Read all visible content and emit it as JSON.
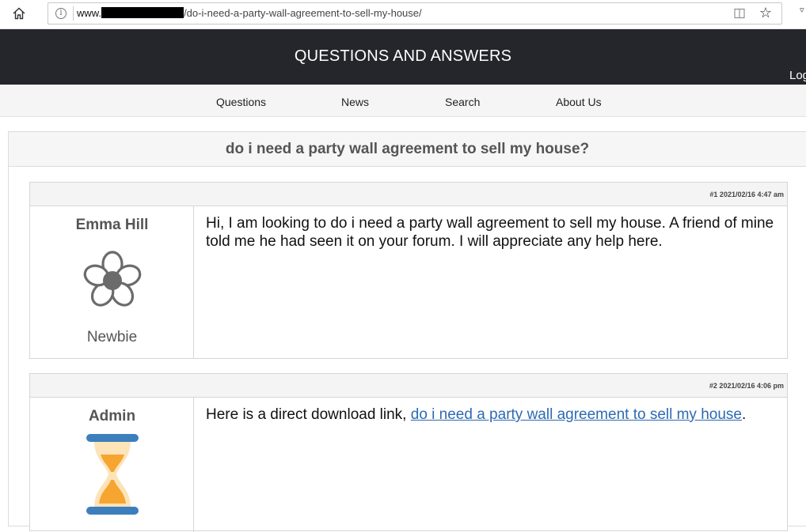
{
  "browser": {
    "url_prefix": "www.",
    "url_path": "/do-i-need-a-party-wall-agreement-to-sell-my-house/"
  },
  "site": {
    "title": "QUESTIONS AND ANSWERS",
    "login_label": "Log"
  },
  "nav": {
    "items": [
      "Questions",
      "News",
      "Search",
      "About Us"
    ]
  },
  "topic": {
    "title": "do i need a party wall agreement to sell my house?"
  },
  "posts": [
    {
      "meta": "#1 2021/02/16 4:47 am",
      "author": "Emma Hill",
      "avatar": "flower-icon",
      "rank": "Newbie",
      "text": "Hi, I am looking to do i need a party wall agreement to sell my house. A friend of mine told me he had seen it on your forum. I will appreciate any help here."
    },
    {
      "meta": "#2 2021/02/16 4:06 pm",
      "author": "Admin",
      "avatar": "hourglass-icon",
      "text_prefix": "Here is a direct download link, ",
      "link_text": "do i need a party wall agreement to sell my house",
      "text_suffix": "."
    }
  ],
  "colors": {
    "header_bg": "#24262b",
    "link": "#2d6ab2",
    "hourglass_bar": "#3d7fbd",
    "hourglass_sand": "#f7a531"
  }
}
